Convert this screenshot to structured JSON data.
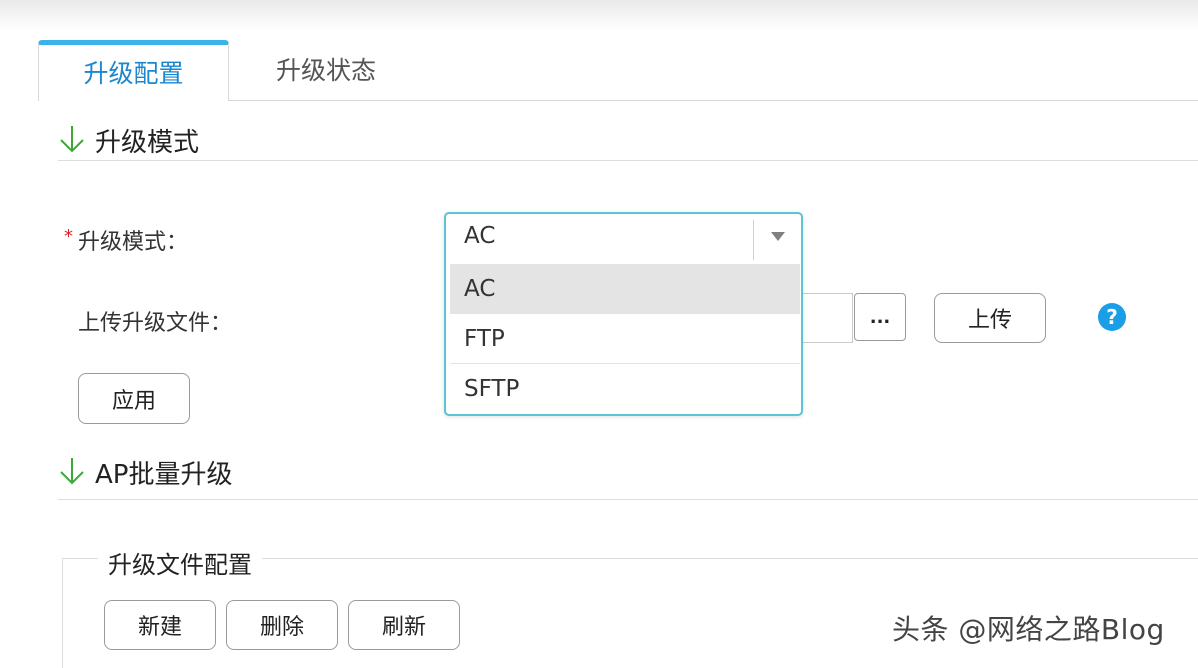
{
  "tabs": [
    {
      "label": "升级配置",
      "active": true
    },
    {
      "label": "升级状态",
      "active": false
    }
  ],
  "sections": {
    "upgrade_mode": {
      "title": "升级模式"
    },
    "ap_batch": {
      "title": "AP批量升级"
    }
  },
  "form": {
    "required_mark": "*",
    "mode_label": "升级模式：",
    "upload_label": "上传升级文件：",
    "browse_label": "...",
    "upload_button": "上传",
    "apply_button": "应用",
    "help_icon": "?"
  },
  "mode_select": {
    "value": "AC",
    "options": [
      {
        "label": "AC",
        "selected": true
      },
      {
        "label": "FTP",
        "selected": false
      },
      {
        "label": "SFTP",
        "selected": false
      }
    ]
  },
  "upgrade_file_config": {
    "legend": "升级文件配置",
    "buttons": {
      "new": "新建",
      "delete": "删除",
      "refresh": "刷新"
    }
  },
  "watermark": "头条 @网络之路Blog",
  "colors": {
    "accent": "#39b3e8",
    "active_tab_text": "#1a87cf",
    "arrow_green": "#3aaa35",
    "required_red": "#e02020",
    "help_blue": "#1a9ee6",
    "select_border": "#5ec3d6"
  },
  "icons": {
    "section": "down-arrow-icon",
    "select": "chevron-down-icon",
    "help": "help-icon"
  }
}
